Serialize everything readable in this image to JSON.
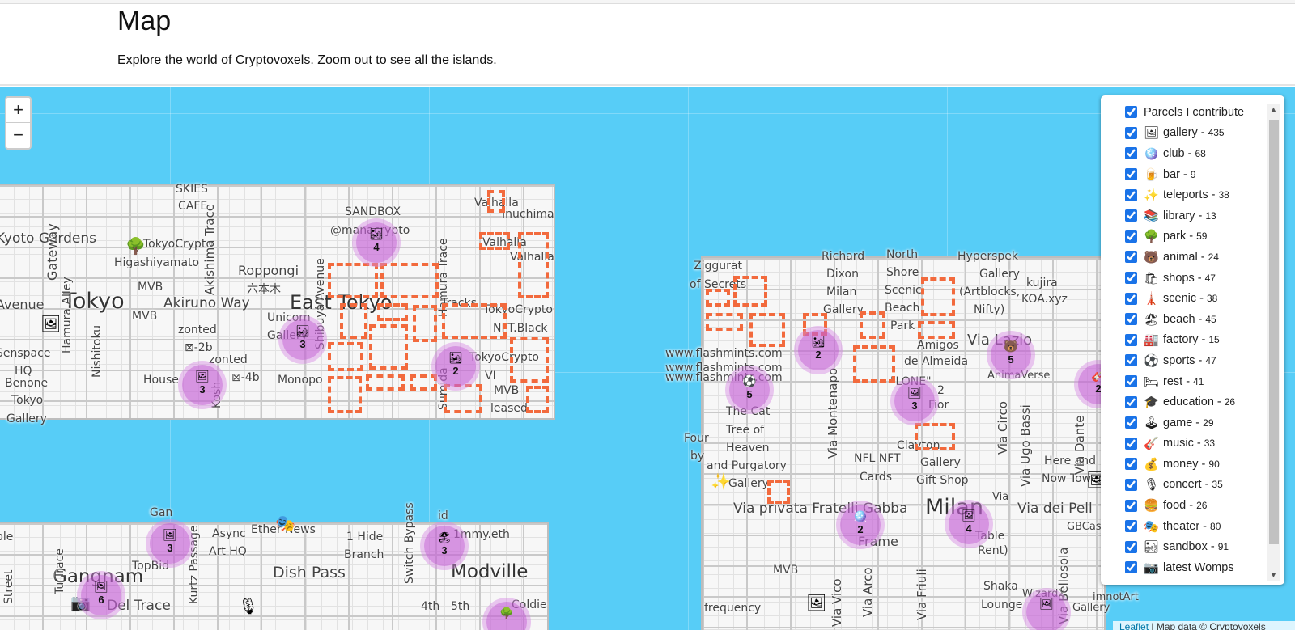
{
  "header": {
    "title": "Map",
    "subtitle": "Explore the world of Cryptovoxels. Zoom out to see all the islands."
  },
  "zoom": {
    "in_label": "+",
    "out_label": "−"
  },
  "districts": [
    "Tokyo",
    "East Tokyo",
    "Milan",
    "Gangnam",
    "Modville"
  ],
  "streets": {
    "tokyo": [
      "SKIES",
      "CAFE",
      "SANDBOX",
      "@manacrypto",
      "Valhalla",
      "Inuchima",
      "Valhalla",
      "Valhalla",
      "Kyoto Gardens",
      "TokyoCrypto",
      "Higashiyamato",
      "Roppongi",
      "六本木",
      "MVB",
      "Avenue",
      "Akiruno Way",
      "MVB",
      "Unicorn",
      "Gallery",
      "zonted",
      "⊠-2b",
      "zonted",
      "⊠-4b",
      "Senspace",
      "HQ",
      "Benone",
      "Tokyo",
      "Gallery",
      "House",
      "Monopo",
      "TokyoCrypto",
      "NFT.Black",
      "TokyoCrypto",
      "VI",
      "MVB",
      "leased",
      "Gateway",
      "Akishima Trace",
      "Hamura Alley",
      "Nishitoku",
      "Shibuya Avenue",
      "Kosh",
      "Sumida",
      "Hamura Trace",
      "Tracks"
    ],
    "milan": [
      "Ziggurat",
      "of Secrets",
      "Richard",
      "Dixon",
      "Milan",
      "Gallery",
      "North",
      "Shore",
      "Scenic",
      "Beach",
      "Park",
      "Hyperspek",
      "Gallery",
      "(Artblocks,",
      "Nifty)",
      "kujira",
      "KOA.xyz",
      "Via Lazio",
      "www.flashmints.com",
      "www.flashmints.com",
      "www.flashmints.com",
      "Amigos",
      "de Almeida",
      "\"LONE\"",
      "AnimaVerse",
      "The Cat",
      "Tree of",
      "Heaven",
      "and Purgatory",
      "Gallery",
      "Four",
      "by",
      "NFL NFT",
      "Cards",
      "Clayton",
      "Gallery",
      "Gift Shop",
      "Here and",
      "Now Tower",
      "Via privata Fratelli Gabba",
      "Via dei Pell",
      "Frame",
      "Table",
      "Rent)",
      "GBCas",
      "MVB",
      "frequency",
      "Shaka",
      "Lounge",
      "WizardX",
      "imnotArt",
      "Gallery",
      "Via Montenapo",
      "Via Circo",
      "Via Ugo Bassi",
      "Via Dante",
      "Via Arco",
      "Via Friuli",
      "Via Bellosola",
      "Via Vico",
      "Fior",
      "Via",
      "2"
    ],
    "gangnam": [
      "Gan",
      "Async",
      "Art HQ",
      "Ether News",
      "1 Hide",
      "Branch",
      "id",
      "1mmy.eth",
      "TopBid",
      "Dish Pass",
      "Switch Bypass",
      "4th",
      "5th",
      "Coldie",
      "ple",
      "Street",
      "Tu Trace",
      "Kurtz Passage",
      "Del Trace"
    ]
  },
  "clusters": [
    {
      "count": "4",
      "icon": "sandbox-icon"
    },
    {
      "count": "3",
      "icon": "sandbox-icon"
    },
    {
      "count": "3",
      "icon": "gallery-icon"
    },
    {
      "count": "2",
      "icon": "sandbox-icon"
    },
    {
      "count": "2",
      "icon": "sandbox-icon"
    },
    {
      "count": "5",
      "icon": "sports-icon"
    },
    {
      "count": "3",
      "icon": "gallery-icon"
    },
    {
      "count": "5",
      "icon": "animal-icon"
    },
    {
      "count": "2",
      "icon": "music-icon"
    },
    {
      "count": "3",
      "icon": "gallery-icon"
    },
    {
      "count": "3",
      "icon": "beach-icon"
    },
    {
      "count": "6",
      "icon": "gallery-icon"
    },
    {
      "count": "2",
      "icon": "club-icon"
    },
    {
      "count": "4",
      "icon": "gallery-icon"
    },
    {
      "count": "",
      "icon": "gallery-icon"
    },
    {
      "count": "",
      "icon": "park-icon"
    }
  ],
  "layers": {
    "items": [
      {
        "label": "Parcels I contribute",
        "count": "",
        "checked": true,
        "icon": ""
      },
      {
        "label": "gallery",
        "count": "435",
        "checked": true,
        "icon": "🖼"
      },
      {
        "label": "club",
        "count": "68",
        "checked": true,
        "icon": "🪩"
      },
      {
        "label": "bar",
        "count": "9",
        "checked": true,
        "icon": "🍺"
      },
      {
        "label": "teleports",
        "count": "38",
        "checked": true,
        "icon": "✨"
      },
      {
        "label": "library",
        "count": "13",
        "checked": true,
        "icon": "📚"
      },
      {
        "label": "park",
        "count": "59",
        "checked": true,
        "icon": "🌳"
      },
      {
        "label": "animal",
        "count": "24",
        "checked": true,
        "icon": "🐻"
      },
      {
        "label": "shops",
        "count": "47",
        "checked": true,
        "icon": "🛍"
      },
      {
        "label": "scenic",
        "count": "38",
        "checked": true,
        "icon": "🗼"
      },
      {
        "label": "beach",
        "count": "45",
        "checked": true,
        "icon": "🏖"
      },
      {
        "label": "factory",
        "count": "15",
        "checked": true,
        "icon": "🏭"
      },
      {
        "label": "sports",
        "count": "47",
        "checked": true,
        "icon": "⚽"
      },
      {
        "label": "rest",
        "count": "41",
        "checked": true,
        "icon": "🛏"
      },
      {
        "label": "education",
        "count": "26",
        "checked": true,
        "icon": "🎓"
      },
      {
        "label": "game",
        "count": "29",
        "checked": true,
        "icon": "🕹"
      },
      {
        "label": "music",
        "count": "33",
        "checked": true,
        "icon": "🎸"
      },
      {
        "label": "money",
        "count": "90",
        "checked": true,
        "icon": "💰"
      },
      {
        "label": "concert",
        "count": "35",
        "checked": true,
        "icon": "🎙"
      },
      {
        "label": "food",
        "count": "26",
        "checked": true,
        "icon": "🍔"
      },
      {
        "label": "theater",
        "count": "80",
        "checked": true,
        "icon": "🎭"
      },
      {
        "label": "sandbox",
        "count": "91",
        "checked": true,
        "icon": "🏜"
      },
      {
        "label": "latest Womps",
        "count": "",
        "checked": true,
        "icon": "📷"
      }
    ]
  },
  "attribution": {
    "link": "Leaflet",
    "text": " | Map data © Cryptovoxels"
  },
  "colors": {
    "water": "#57cdf7",
    "parcel_outline": "#f26a3d",
    "cluster": "#c460d6"
  }
}
